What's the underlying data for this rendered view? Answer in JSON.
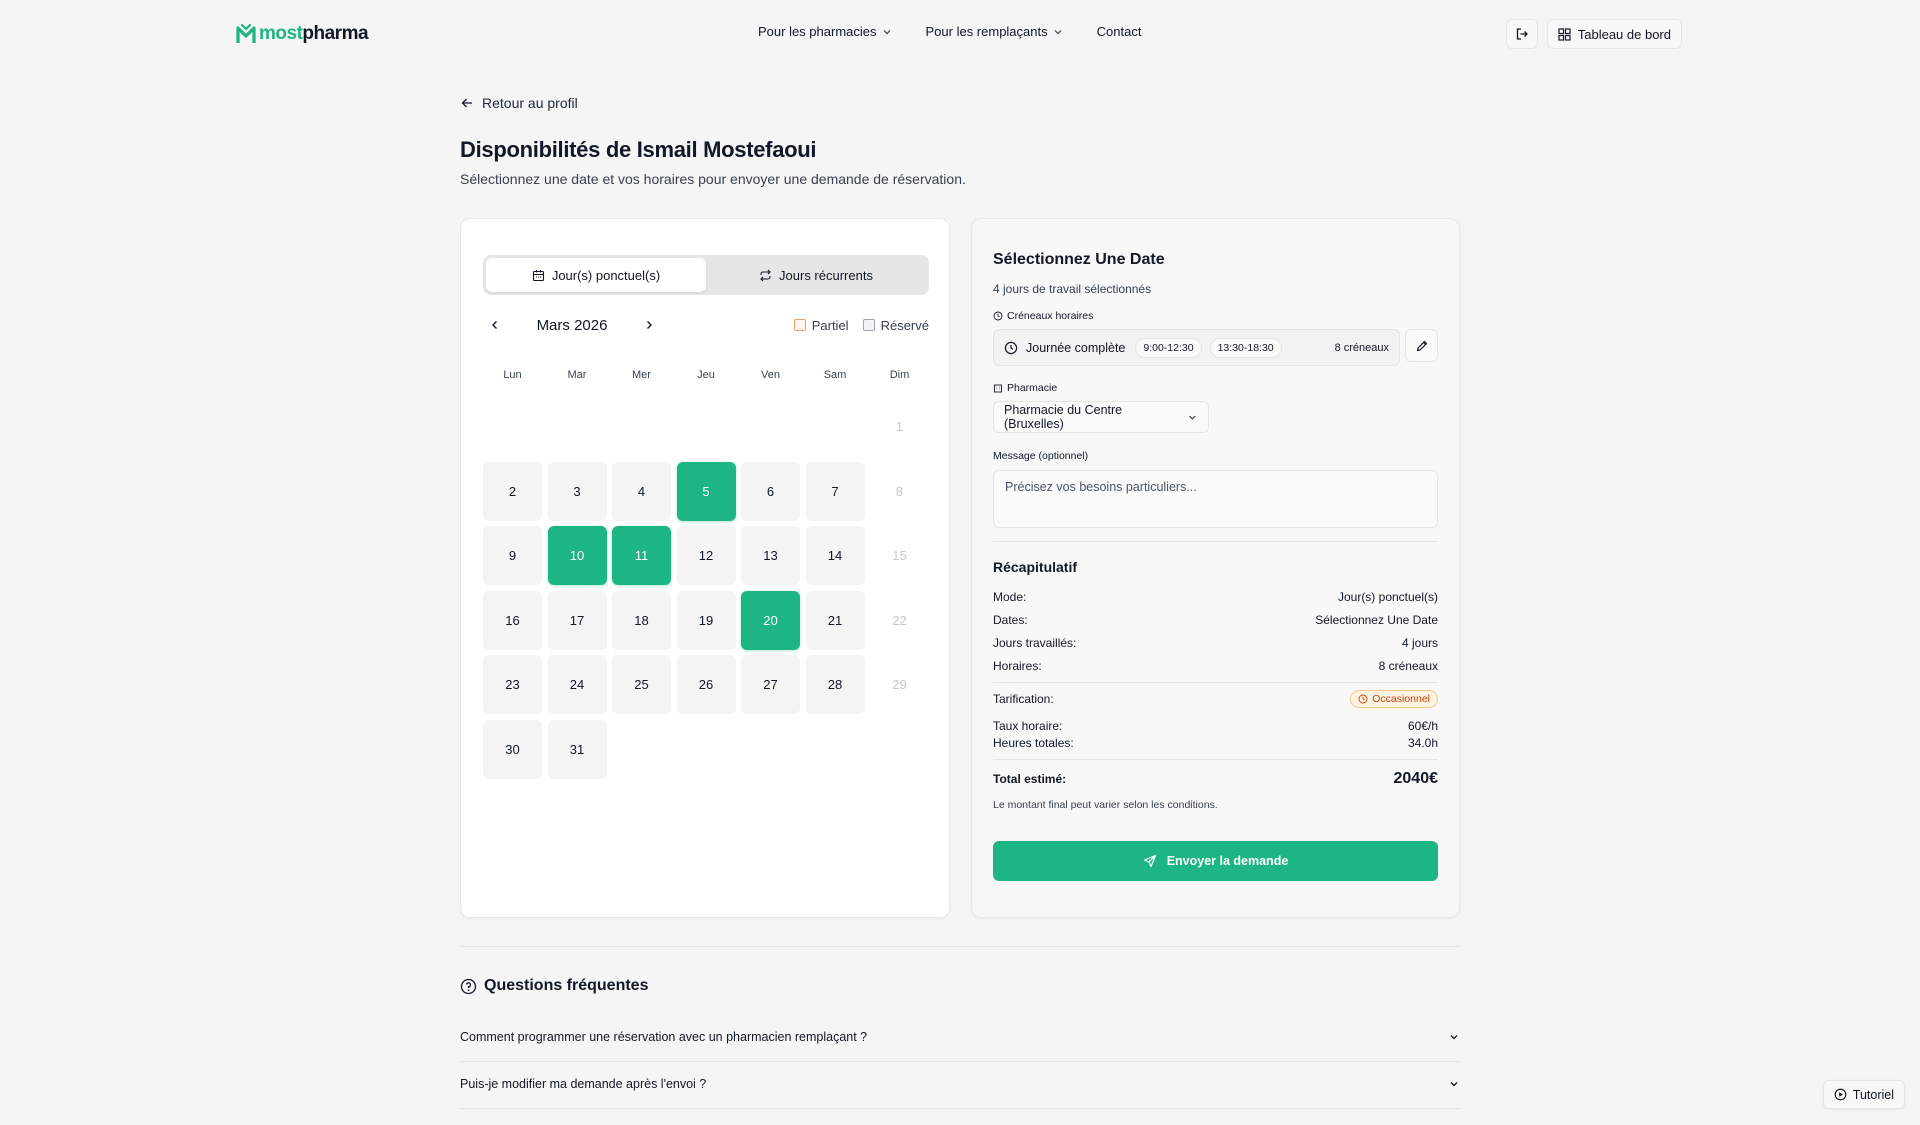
{
  "header": {
    "logo_part1": "most",
    "logo_part2": "pharma",
    "nav": [
      {
        "label": "Pour les pharmacies"
      },
      {
        "label": "Pour les remplaçants"
      },
      {
        "label": "Contact"
      }
    ],
    "dashboard_label": "Tableau de bord"
  },
  "page": {
    "back_label": "Retour au profil",
    "title": "Disponibilités de Ismail Mostefaoui",
    "subtitle": "Sélectionnez une date et vos horaires pour envoyer une demande de réservation."
  },
  "calendar": {
    "modes": [
      {
        "label": "Jour(s) ponctuel(s)",
        "active": true
      },
      {
        "label": "Jours récurrents",
        "active": false
      }
    ],
    "month": "Mars 2026",
    "legend": {
      "partial": "Partiel",
      "reserved": "Réservé"
    },
    "weekdays": [
      "Lun",
      "Mar",
      "Mer",
      "Jeu",
      "Ven",
      "Sam",
      "Dim"
    ],
    "leading_empty": 6,
    "days_in_month": 31,
    "sunday_column_index": 6,
    "selected_days": [
      5,
      10,
      11,
      20
    ]
  },
  "form": {
    "title": "Sélectionnez Une Date",
    "subtitle": "4 jours de travail sélectionnés",
    "slots_label": "Créneaux horaires",
    "slots_main": "Journée complète",
    "slot_pills": [
      "9:00-12:30",
      "13:30-18:30"
    ],
    "slots_count": "8 créneaux",
    "pharmacy_label": "Pharmacie",
    "pharmacy_value": "Pharmacie du Centre (Bruxelles)",
    "message_label": "Message (optionnel)",
    "message_placeholder": "Précisez vos besoins particuliers...",
    "recap_title": "Récapitulatif",
    "recap": [
      {
        "label": "Mode:",
        "value": "Jour(s) ponctuel(s)"
      },
      {
        "label": "Dates:",
        "value": "Sélectionnez Une Date"
      },
      {
        "label": "Jours travaillés:",
        "value": "4 jours"
      },
      {
        "label": "Horaires:",
        "value": "8 créneaux"
      }
    ],
    "pricing_label": "Tarification:",
    "pricing_badge": "Occasionnel",
    "hourly_label": "Taux horaire:",
    "hourly_value": "60€/h",
    "hours_label": "Heures totales:",
    "hours_value": "34.0h",
    "total_label": "Total estimé:",
    "total_value": "2040€",
    "note": "Le montant final peut varier selon les conditions.",
    "send_label": "Envoyer la demande"
  },
  "faq": {
    "title": "Questions fréquentes",
    "questions": [
      "Comment programmer une réservation avec un pharmacien remplaçant ?",
      "Puis-je modifier ma demande après l'envoi ?"
    ]
  },
  "tutorial_label": "Tutoriel",
  "colors": {
    "accent": "#1db584",
    "badge_text": "#c2410c",
    "background": "#f4f5f4"
  }
}
